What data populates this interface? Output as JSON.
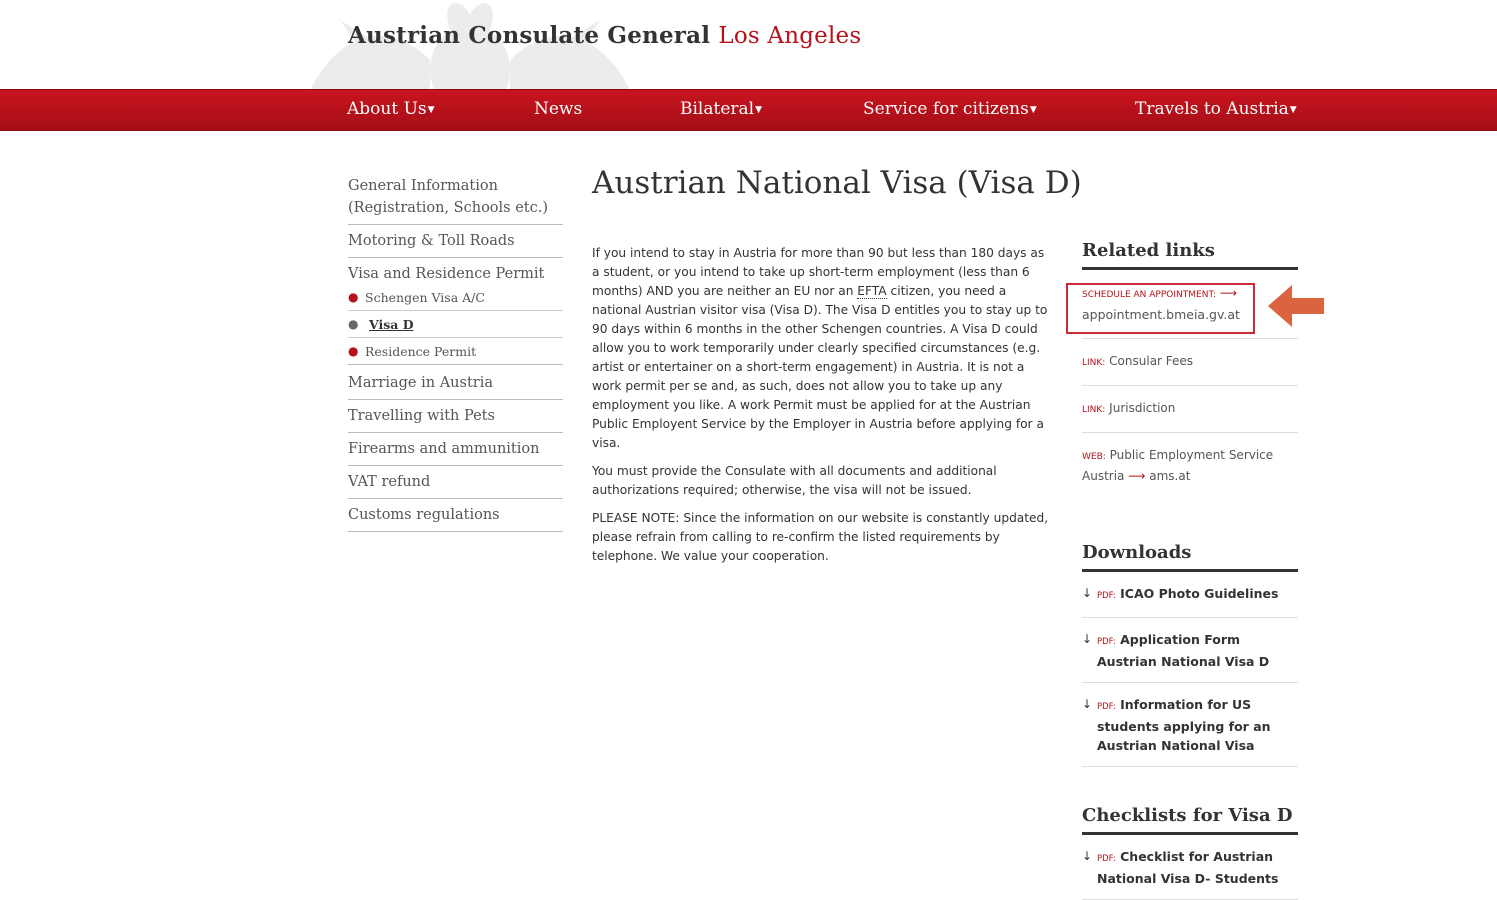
{
  "header": {
    "title_main": "Austrian Consulate General",
    "title_city": "Los Angeles"
  },
  "nav": {
    "items": [
      {
        "label": "About Us",
        "dropdown": true
      },
      {
        "label": "News",
        "dropdown": false
      },
      {
        "label": "Bilateral",
        "dropdown": true
      },
      {
        "label": "Service for citizens",
        "dropdown": true
      },
      {
        "label": "Travels to Austria",
        "dropdown": true
      }
    ]
  },
  "sidebar": {
    "items": [
      "General Information (Registration, Schools etc.)",
      "Motoring & Toll Roads",
      "Visa and Residence Permit"
    ],
    "subitems": [
      "Schengen Visa A/C",
      "Visa D",
      "Residence Permit"
    ],
    "items_after": [
      "Marriage in Austria",
      "Travelling with Pets",
      "Firearms and ammunition",
      "VAT refund",
      "Customs regulations"
    ]
  },
  "main": {
    "title": "Austrian National Visa (Visa D)",
    "p1_a": "If you intend to stay in Austria for more than 90 but less than 180 days as a student, or you intend to take up short-term employment (less than 6 months) AND you are neither an EU nor an ",
    "p1_abbr": "EFTA",
    "p1_b": " citizen, you need a national Austrian visitor visa (Visa D). The Visa D entitles you to stay up to 90 days within 6 months in the other Schengen countries. A Visa D could allow you to work temporarily under clearly specified circumstances (e.g. artist or entertainer on a short-term engagement) in Austria. It is not a work permit per se and, as such, does not allow you to take up any employment you like. A work Permit must be applied for at the Austrian Public Employent Service by the Employer in Austria before applying for a visa.",
    "p2": "You must provide the Consulate with all documents and additional authorizations required; otherwise, the visa will not be issued.",
    "p3": "PLEASE NOTE: Since the information on our website is constantly updated, please refrain from calling to re-confirm the listed requirements by telephone. We value your cooperation."
  },
  "related": {
    "heading": "Related links",
    "links": [
      {
        "tag": "Schedule an appointment:",
        "arrow": "⟶",
        "text": "appointment.bmeia.gv.at"
      },
      {
        "tag": "Link:",
        "text": "Consular Fees"
      },
      {
        "tag": "Link:",
        "text": "Jurisdiction"
      },
      {
        "tag": "Web:",
        "text": "Public Employment Service Austria",
        "arrow": "⟶",
        "text2": "ams.at"
      }
    ]
  },
  "downloads": {
    "heading": "Downloads",
    "items": [
      {
        "tag": "PDF:",
        "text": "ICAO Photo Guidelines"
      },
      {
        "tag": "PDF:",
        "text": "Application Form Austrian National Visa D"
      },
      {
        "tag": "PDF:",
        "text": "Information for US students applying for an Austrian National Visa"
      }
    ]
  },
  "checklists": {
    "heading": "Checklists for Visa D",
    "items": [
      {
        "tag": "PDF:",
        "text": "Checklist for Austrian National Visa D- Students"
      }
    ]
  },
  "colors": {
    "brand_red": "#b5121b",
    "annotation_red": "#cc2b35",
    "annotation_arrow": "#d9643f"
  }
}
